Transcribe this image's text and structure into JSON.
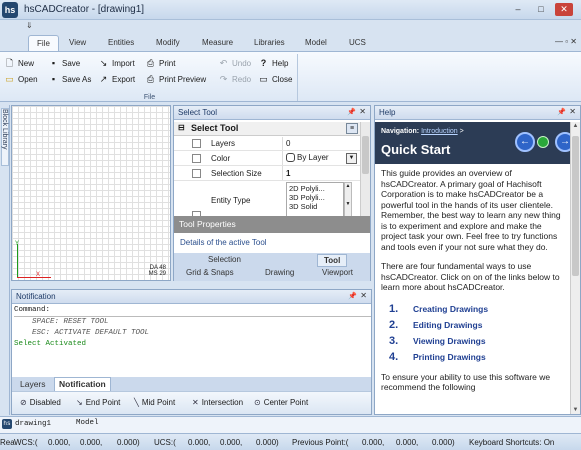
{
  "window": {
    "title": "hsCADCreator - [drawing1]",
    "logo": "hs",
    "min": "–",
    "max": "□",
    "close": "✕"
  },
  "quick_access": {
    "arrow": "⇓"
  },
  "ribbon": {
    "tabs": [
      "File",
      "View",
      "Entities",
      "Modify",
      "Measure",
      "Libraries",
      "Model",
      "UCS"
    ],
    "right": "— ▫ ✕",
    "file_group": {
      "label": "File",
      "buttons": {
        "new": "New",
        "open": "Open",
        "save": "Save",
        "save_as": "Save As",
        "import": "Import",
        "export": "Export",
        "print": "Print",
        "print_preview": "Print Preview",
        "undo": "Undo",
        "redo": "Redo",
        "help": "Help",
        "close": "Close"
      }
    }
  },
  "side_strip": {
    "tab": "Block Library"
  },
  "drawing": {
    "axis_y": "Y",
    "axis_x": "X",
    "coord_lines": [
      "DA 48",
      "MS 29"
    ]
  },
  "select_tool": {
    "title": "Select Tool",
    "header": "Select Tool",
    "props": {
      "layers": {
        "label": "Layers",
        "value": "0"
      },
      "color": {
        "label": "Color",
        "value": "By Layer"
      },
      "selection_size": {
        "label": "Selection Size",
        "value": "1"
      },
      "entity_type": {
        "label": "Entity Type",
        "options": [
          "2D Polyli...",
          "3D Polyli...",
          "3D Solid"
        ]
      }
    },
    "tool_properties": "Tool Properties",
    "details": "Details of the active Tool",
    "tabs": [
      "Selection",
      "Tool",
      "Grid & Snaps",
      "Drawing",
      "Viewport"
    ]
  },
  "help": {
    "title": "Help",
    "nav_label": "Navigation:",
    "nav_link": "Introduction",
    "nav_sep": ">",
    "page_title": "Quick Start",
    "back": "←",
    "forward": "→",
    "para1": "This guide provides an overview of hsCADCreator. A primary goal of Hachisoft Corporation is to make hsCADCreator be a powerful tool in the hands of its user clientele. Remember, the best way to learn any new thing is to experiment and explore and make the project task your own. Feel free to try functions and tools even if your not sure what they do.",
    "para2": "There are four fundamental ways to use hsCADCreator. Click on on of the links below to learn more about hsCADCreator.",
    "links": [
      {
        "num": "1.",
        "label": "Creating Drawings"
      },
      {
        "num": "2.",
        "label": "Editing Drawings"
      },
      {
        "num": "3.",
        "label": "Viewing Drawings"
      },
      {
        "num": "4.",
        "label": "Printing Drawings"
      }
    ],
    "para3": "To ensure your ability to use this software we recommend the following"
  },
  "notification": {
    "title": "Notification",
    "command": "Command:",
    "lines": [
      "SPACE: RESET TOOL",
      "ESC: ACTIVATE DEFAULT TOOL"
    ],
    "status_line": "Select Activated",
    "tabs": [
      "Layers",
      "Notification"
    ],
    "snaps": [
      "Disabled",
      "End Point",
      "Mid Point",
      "Intersection",
      "Center Point"
    ]
  },
  "doc_tabs": [
    "drawing1",
    "Model"
  ],
  "status": {
    "left": "Rea",
    "wcs_label": "WCS:(",
    "wcs": [
      "0.000,",
      "0.000,",
      "0.000)"
    ],
    "ucs_label": "UCS:(",
    "ucs": [
      "0.000,",
      "0.000,",
      "0.000)"
    ],
    "prev_label": "Previous Point:(",
    "prev": [
      "0.000,",
      "0.000,",
      "0.000)"
    ],
    "shortcuts": "Keyboard Shortcuts: On"
  }
}
